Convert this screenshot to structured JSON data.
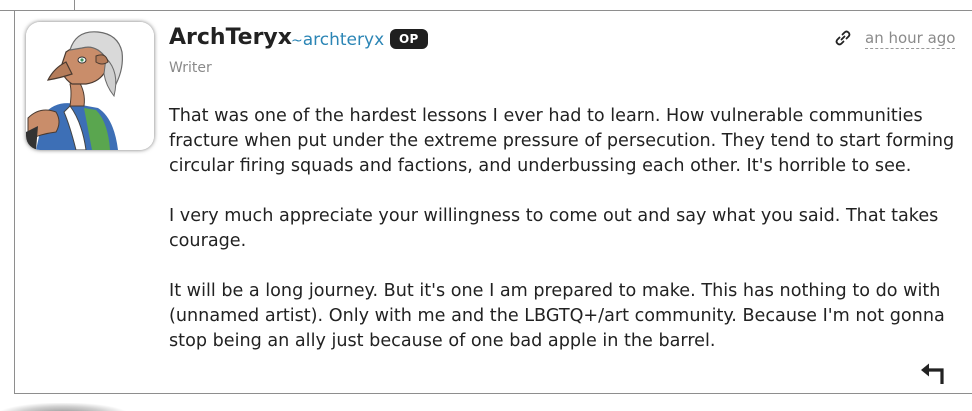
{
  "comment": {
    "author": {
      "name": "ArchTeryx",
      "handle_prefix": "~",
      "handle": "archteryx",
      "badge": "OP",
      "role": "Writer",
      "avatar_icon": "anthro-character-avatar"
    },
    "timestamp": "an hour ago",
    "permalink_icon": "link-icon",
    "reply_icon": "reply-arrow-icon",
    "paragraphs": [
      "That was one of the hardest lessons I ever had to learn. How vulnerable communities fracture when put under the extreme pressure of persecution. They tend to start forming circular firing squads and factions, and underbussing each other. It's horrible to see.",
      "I very much appreciate your willingness to come out and say what you said. That takes courage.",
      "It will be a long journey. But it's one I am prepared to make. This has nothing to do with (unnamed artist). Only with me and the LBGTQ+/art community. Because I'm not gonna stop being an ally just because of one bad apple in the barrel."
    ]
  },
  "colors": {
    "text": "#222222",
    "muted": "#8a8a8a",
    "handle": "#2b85b5",
    "badge_bg": "#1f1f1f",
    "border": "#8e8e8e"
  }
}
